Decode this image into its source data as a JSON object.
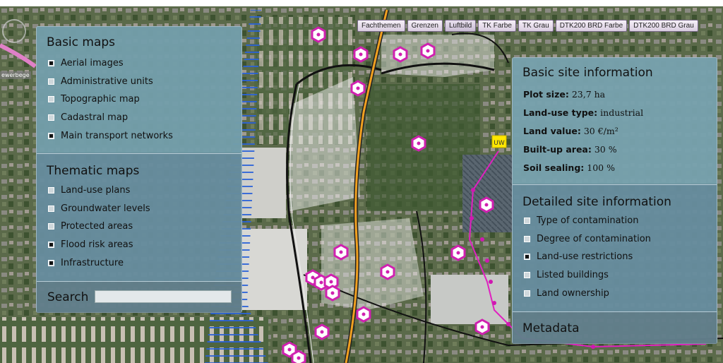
{
  "layer_tabs": [
    "Fachthemen",
    "Grenzen",
    "Luftbild",
    "TK Farbe",
    "TK Grau",
    "DTK200 BRD Farbe",
    "DTK200 BRD Grau"
  ],
  "map": {
    "edge_label": "ewerbege",
    "marker_label": "UW",
    "colors": {
      "rail_line": "#f0a020",
      "track_line": "#e020c0",
      "border_line": "#2060d0",
      "marker_fill": "#ffe800"
    }
  },
  "left_panel": {
    "basic_maps": {
      "title": "Basic maps",
      "items": [
        {
          "label": "Aerial images",
          "checked": true
        },
        {
          "label": "Administrative units",
          "checked": false
        },
        {
          "label": "Topographic map",
          "checked": false
        },
        {
          "label": "Cadastral map",
          "checked": false
        },
        {
          "label": "Main transport networks",
          "checked": true
        }
      ]
    },
    "thematic_maps": {
      "title": "Thematic maps",
      "items": [
        {
          "label": "Land-use plans",
          "checked": false
        },
        {
          "label": "Groundwater levels",
          "checked": false
        },
        {
          "label": "Protected areas",
          "checked": false
        },
        {
          "label": "Flood risk areas",
          "checked": true
        },
        {
          "label": "Infrastructure",
          "checked": true
        }
      ]
    },
    "search": {
      "label": "Search",
      "value": ""
    }
  },
  "right_panel": {
    "basic_info": {
      "title": "Basic site information",
      "rows": [
        {
          "label": "Plot size:",
          "value": "23,7 ha"
        },
        {
          "label": "Land-use type:",
          "value": "industrial"
        },
        {
          "label": "Land value:",
          "value": "30 €/m²"
        },
        {
          "label": "Built-up area:",
          "value": "30 %"
        },
        {
          "label": "Soil sealing:",
          "value": "100 %"
        }
      ]
    },
    "detailed_info": {
      "title": "Detailed site information",
      "items": [
        {
          "label": "Type of contamination",
          "checked": false
        },
        {
          "label": "Degree of contamination",
          "checked": false
        },
        {
          "label": "Land-use restrictions",
          "checked": true
        },
        {
          "label": "Listed buildings",
          "checked": false
        },
        {
          "label": "Land ownership",
          "checked": false
        }
      ]
    },
    "metadata": {
      "title": "Metadata"
    }
  }
}
